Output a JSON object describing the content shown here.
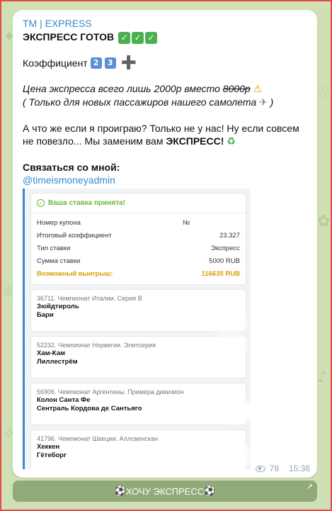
{
  "channel": "TM | EXPRESS",
  "title": "ЭКСПРЕСС ГОТОВ",
  "title_check_count": 3,
  "coef_label": "Коэффициент",
  "coef_digits": [
    "2",
    "3"
  ],
  "price_text": "Цена экспресса всего лишь 2000р вместо ",
  "price_old": "8000р",
  "price_note": "( Только для новых пассажиров нашего самолета ",
  "price_note_end": " )",
  "lose_text_1": "А что же если я проиграю? Только не у нас! Ну если совсем не повезло... Мы заменим вам ",
  "lose_text_bold": "ЭКСПРЕСС!",
  "contact_label": "Связаться со мной:",
  "contact_link": "@timeismoneyadmin",
  "coupon": {
    "accepted": "Ваша ставка принята!",
    "rows": [
      {
        "label": "Номер купона",
        "mid": "№",
        "value": ""
      },
      {
        "label": "Итоговый коэффициент",
        "mid": "",
        "value": "23.327"
      },
      {
        "label": "Тип ставки",
        "mid": "",
        "value": "Экспресс"
      },
      {
        "label": "Сумма ставки",
        "mid": "",
        "value": "5000 RUB"
      },
      {
        "label": "Возможный выигрыш:",
        "mid": "",
        "value": "116635 RUB"
      }
    ],
    "matches": [
      {
        "league": "36711. Чемпионат Италии. Серия B",
        "team1": "Зюйдтироль",
        "team2": "Бари"
      },
      {
        "league": "52232. Чемпионат Норвегии. Элитсерия",
        "team1": "Хам-Кам",
        "team2": "Лиллестрём"
      },
      {
        "league": "56906. Чемпионат Аргентины. Примера дивизион",
        "team1": "Колон Санта Фе",
        "team2": "Сентраль Кордова де Сантьяго"
      },
      {
        "league": "41796. Чемпионат Швеции. Аллсвенскан",
        "team1": "Хеккен",
        "team2": "Гётеборг"
      }
    ]
  },
  "views": "78",
  "time": "15:36",
  "cta_label": "ХОЧУ ЭКСПРЕСС",
  "colors": {
    "accent": "#3a89c9",
    "win": "#d9a000",
    "accepted": "#6cb63a",
    "background": "#cfe0b4"
  }
}
